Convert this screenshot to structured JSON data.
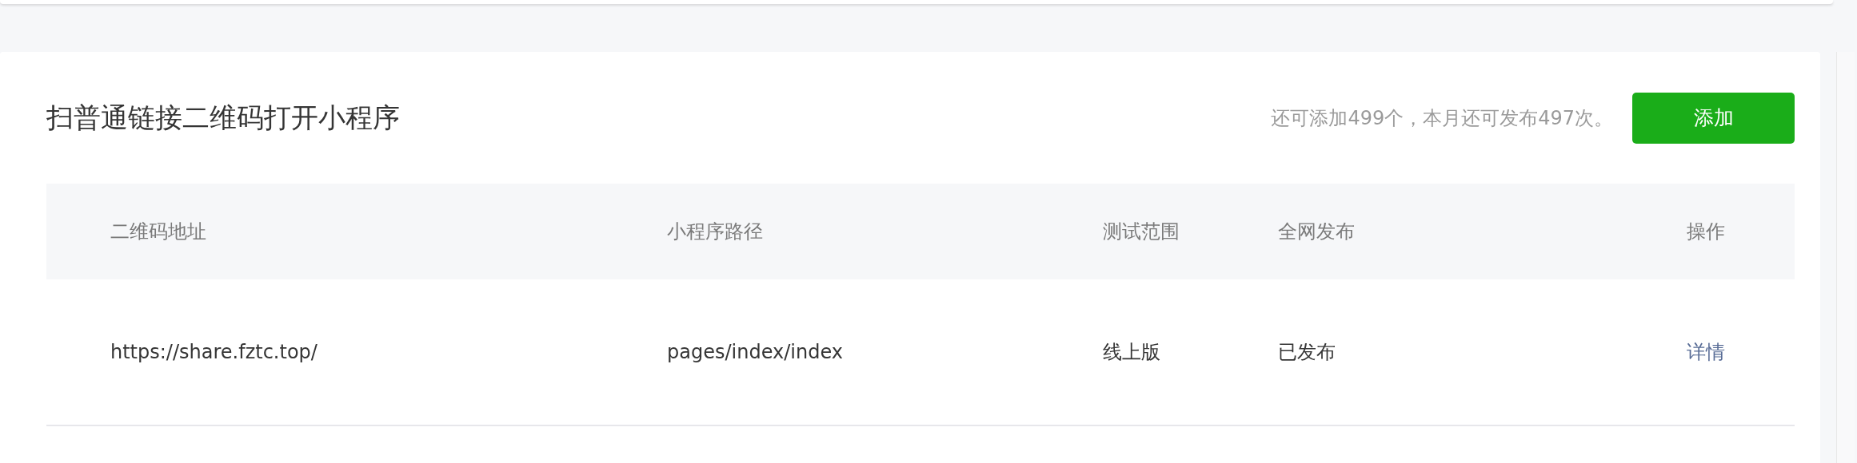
{
  "section": {
    "title": "扫普通链接二维码打开小程序",
    "quota_hint": "还可添加499个，本月还可发布497次。",
    "add_button": "添加"
  },
  "table": {
    "columns": [
      "二维码地址",
      "小程序路径",
      "测试范围",
      "全网发布",
      "操作"
    ],
    "rows": [
      {
        "qr_url": "https://share.fztc.top/",
        "path": "pages/index/index",
        "test_scope": "线上版",
        "release": "已发布",
        "action": "详情"
      }
    ]
  }
}
